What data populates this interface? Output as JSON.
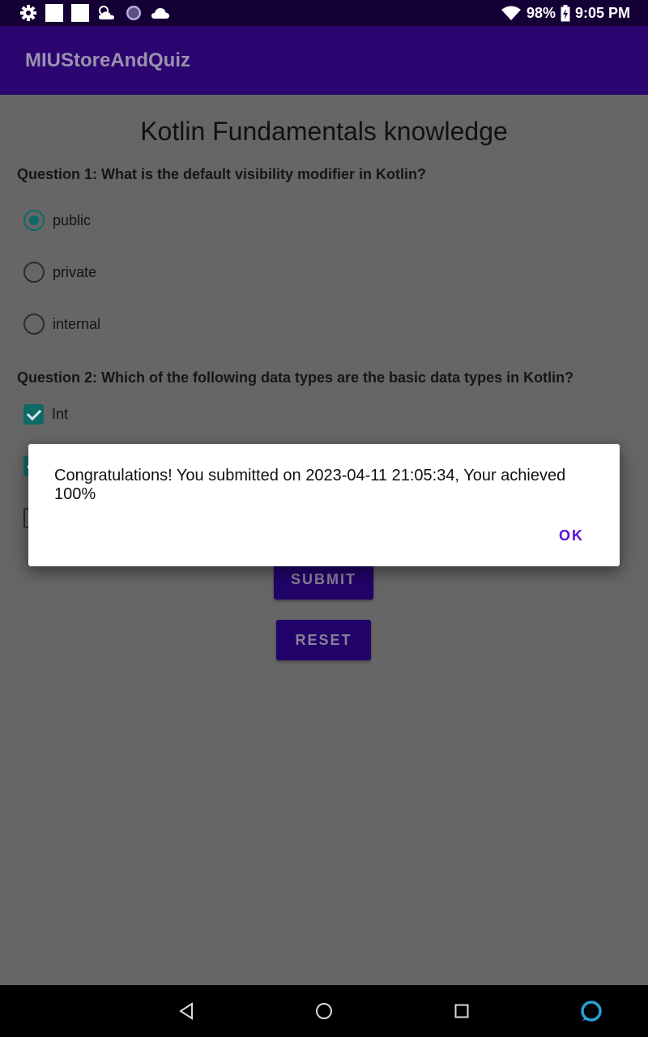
{
  "status_bar": {
    "icons": [
      "gear-icon",
      "notification-square-icon",
      "notification-square-icon",
      "weather-icon",
      "circle-app-icon",
      "cloud-icon"
    ],
    "right_icons": [
      "wifi-icon",
      "battery-charging-icon"
    ],
    "battery": "98%",
    "time": "9:05 PM"
  },
  "app_bar": {
    "title": "MIUStoreAndQuiz"
  },
  "quiz": {
    "title": "Kotlin Fundamentals knowledge",
    "q1": {
      "text": "Question 1: What is the default visibility modifier in Kotlin?",
      "options": [
        {
          "label": "public",
          "checked": true
        },
        {
          "label": "private",
          "checked": false
        },
        {
          "label": "internal",
          "checked": false
        }
      ]
    },
    "q2": {
      "text": "Question 2: Which of the following data types are the basic data types in Kotlin?",
      "options": [
        {
          "label": "Int",
          "checked": true
        }
      ]
    },
    "submit_label": "SUBMIT",
    "reset_label": "RESET"
  },
  "dialog": {
    "message": "Congratulations! You submitted on 2023-04-11 21:05:34, Your achieved 100%",
    "ok_label": "OK"
  },
  "nav_bar": {
    "icons": [
      "back-icon",
      "home-icon",
      "recents-icon",
      "assistant-icon"
    ]
  },
  "colors": {
    "app_bar": "#2b0570",
    "status_bar": "#140034",
    "accent": "#0e6a66",
    "dialog_button": "#5a0bd6",
    "scrim_background": "#666666"
  }
}
